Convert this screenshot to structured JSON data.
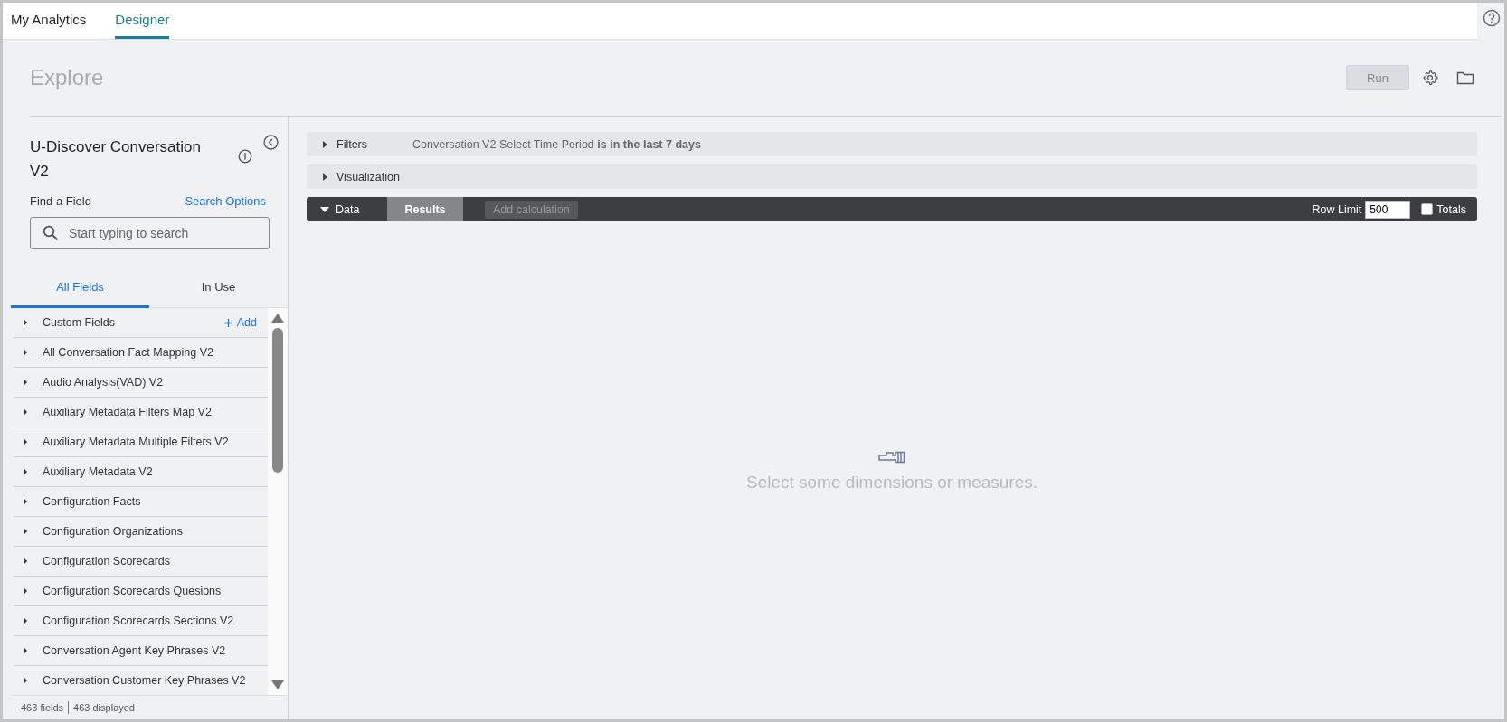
{
  "top_nav": {
    "tabs": [
      {
        "label": "My Analytics",
        "selected": false
      },
      {
        "label": "Designer",
        "selected": true
      }
    ]
  },
  "header": {
    "title": "Explore",
    "run_button": {
      "label": "Run",
      "disabled": true
    }
  },
  "sidebar": {
    "title": "U-Discover Conversation V2",
    "find_label": "Find a Field",
    "search_options": "Search Options",
    "search": {
      "placeholder": "Start typing to search"
    },
    "tabs": [
      {
        "label": "All Fields",
        "selected": true
      },
      {
        "label": "In Use",
        "selected": false
      }
    ],
    "add_label": "Add",
    "items": [
      {
        "label": "Custom Fields",
        "kind": "custom"
      },
      {
        "label": "All Conversation Fact Mapping V2",
        "kind": "view"
      },
      {
        "label": "Audio Analysis(VAD) V2",
        "kind": "view"
      },
      {
        "label": "Auxiliary Metadata Filters Map V2",
        "kind": "view"
      },
      {
        "label": "Auxiliary Metadata Multiple Filters V2",
        "kind": "view"
      },
      {
        "label": "Auxiliary Metadata V2",
        "kind": "view"
      },
      {
        "label": "Configuration Facts",
        "kind": "view"
      },
      {
        "label": "Configuration Organizations",
        "kind": "view"
      },
      {
        "label": "Configuration Scorecards",
        "kind": "view"
      },
      {
        "label": "Configuration Scorecards Quesions",
        "kind": "view"
      },
      {
        "label": "Configuration Scorecards Sections V2",
        "kind": "view"
      },
      {
        "label": "Conversation Agent Key Phrases V2",
        "kind": "view"
      },
      {
        "label": "Conversation Customer Key Phrases V2",
        "kind": "view"
      }
    ],
    "footer_fields": "463 fields",
    "footer_displayed": "463 displayed"
  },
  "sections": [
    {
      "label": "Filters",
      "expanded": false,
      "summary": "Conversation V2 Select Time Period **is in the last 7 days**"
    },
    {
      "label": "Visualization",
      "expanded": false
    }
  ],
  "data_bar": {
    "label": "Data",
    "expanded": true,
    "tabs": [
      {
        "label": "Results",
        "selected": true
      }
    ],
    "add_calculation": {
      "label": "Add calculation",
      "disabled": true
    },
    "row_limit_label": "Row Limit",
    "row_limit": "500",
    "totals": {
      "label": "Totals",
      "checked": false
    }
  },
  "empty_message": "Select some dimensions or measures."
}
